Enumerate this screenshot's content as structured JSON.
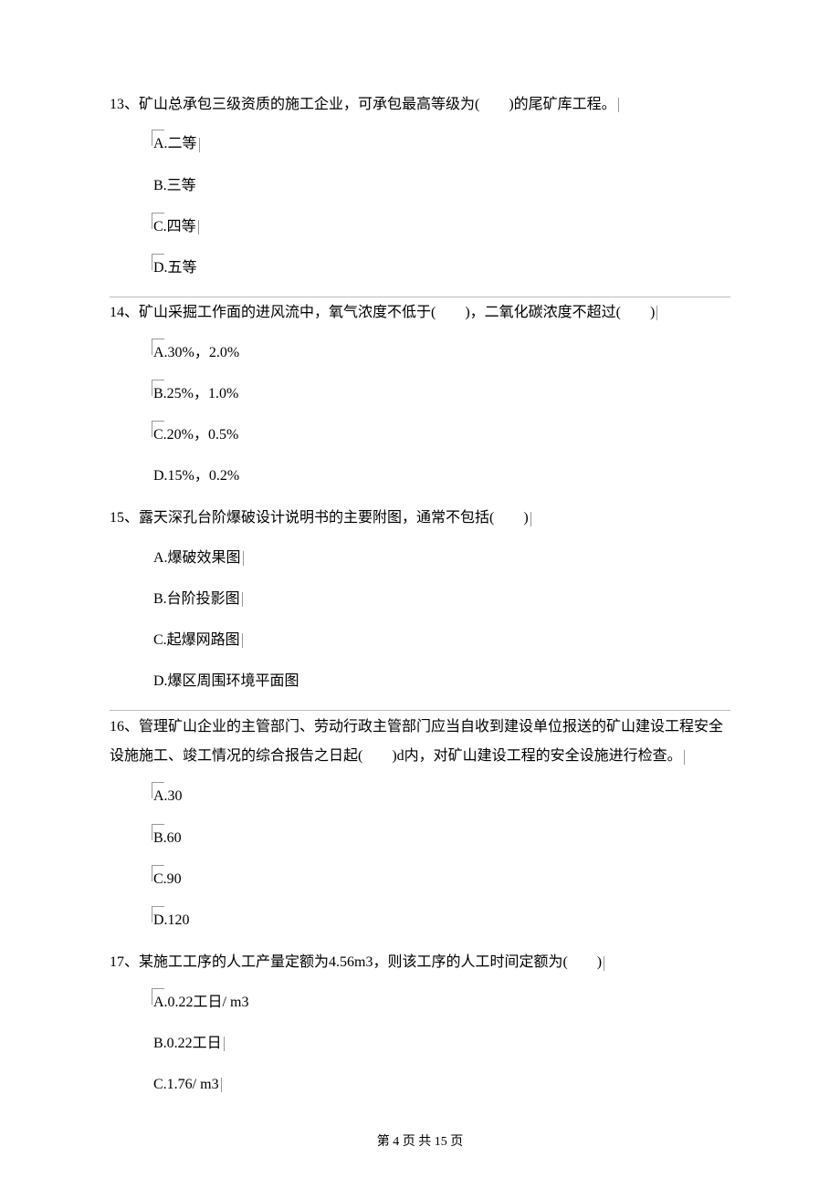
{
  "questions": [
    {
      "number": "13、",
      "text": "矿山总承包三级资质的施工企业，可承包最高等级为(　　)的尾矿库工程。",
      "options": [
        "A.二等",
        "B.三等",
        "C.四等",
        "D.五等"
      ]
    },
    {
      "number": "14、",
      "text": "矿山采掘工作面的进风流中，氧气浓度不低于(　　)，二氧化碳浓度不超过(　　)",
      "options": [
        "A.30%，2.0%",
        "B.25%，1.0%",
        "C.20%，0.5%",
        "D.15%，0.2%"
      ]
    },
    {
      "number": "15、",
      "text": "露天深孔台阶爆破设计说明书的主要附图，通常不包括(　　)",
      "options": [
        "A.爆破效果图",
        "B.台阶投影图",
        "C.起爆网路图",
        "D.爆区周围环境平面图"
      ]
    },
    {
      "number": "16、",
      "text": "管理矿山企业的主管部门、劳动行政主管部门应当自收到建设单位报送的矿山建设工程安全设施施工、竣工情况的综合报告之日起(　　)d内，对矿山建设工程的安全设施进行检查。",
      "options": [
        "A.30",
        "B.60",
        "C.90",
        "D.120"
      ]
    },
    {
      "number": "17、",
      "text": "某施工工序的人工产量定额为4.56m3，则该工序的人工时间定额为(　　)",
      "options": [
        "A.0.22工日/ m3",
        "B.0.22工日",
        "C.1.76/ m3"
      ]
    }
  ],
  "footer": {
    "prefix": "第 ",
    "current": "4",
    "middle": " 页 共 ",
    "total": "15",
    "suffix": " 页"
  }
}
